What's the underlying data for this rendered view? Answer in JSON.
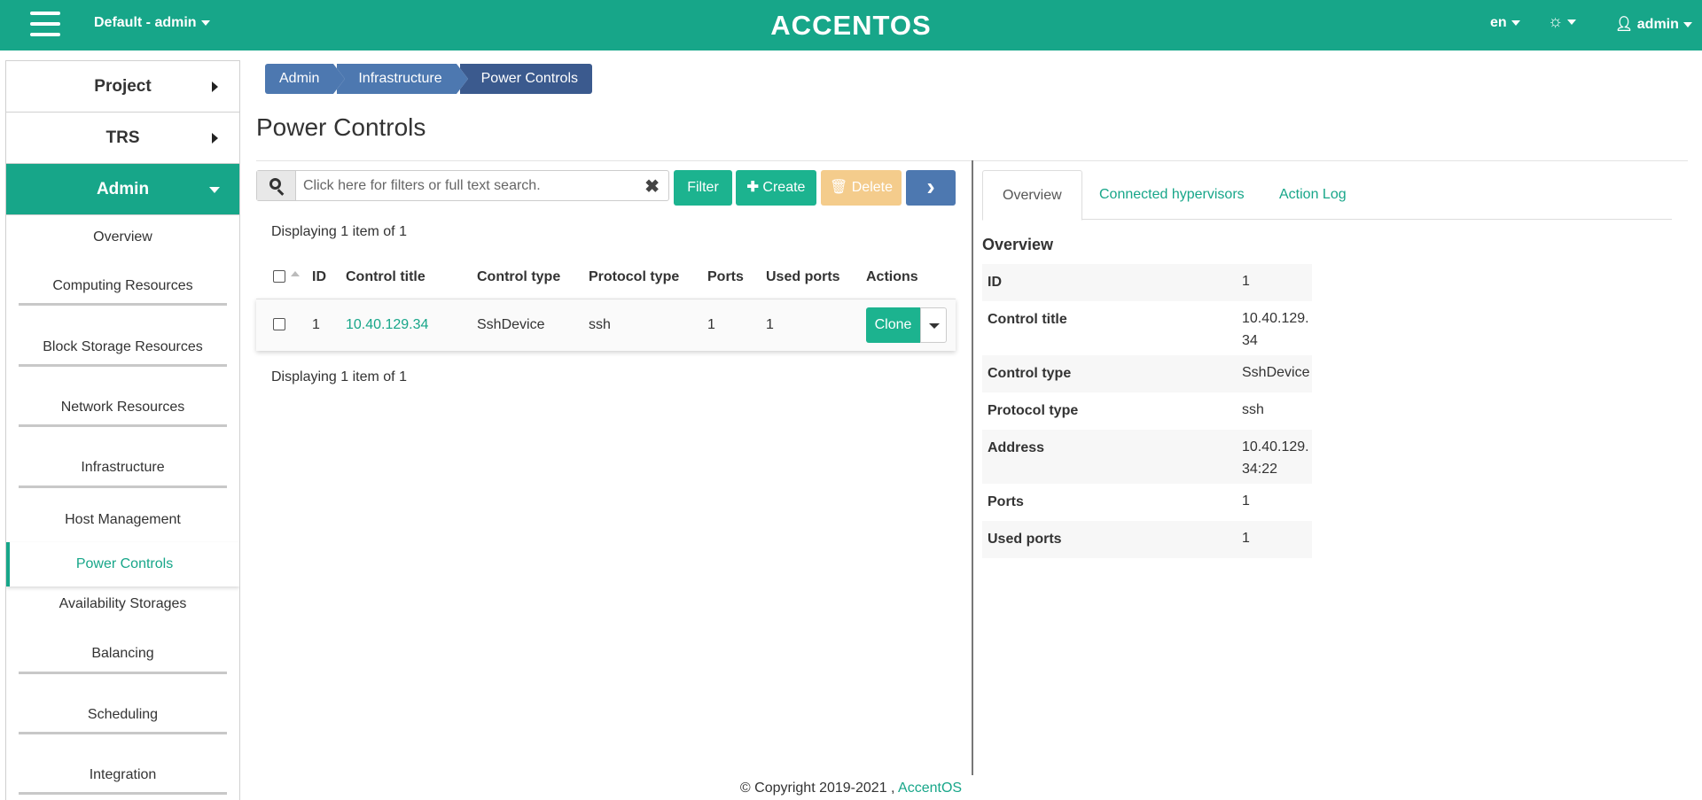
{
  "topbar": {
    "project": "Default - admin",
    "logo": "ACCENTOS",
    "lang": "en",
    "user": "admin"
  },
  "sidebar": {
    "sections": [
      {
        "label": "Project"
      },
      {
        "label": "TRS"
      },
      {
        "label": "Admin"
      }
    ],
    "items": [
      {
        "label": "Overview"
      },
      {
        "label": "Computing Resources"
      },
      {
        "label": "Block Storage Resources"
      },
      {
        "label": "Network Resources"
      },
      {
        "label": "Infrastructure"
      },
      {
        "label": "Host Management"
      },
      {
        "label": "Power Controls"
      },
      {
        "label": "Availability Storages"
      },
      {
        "label": "Balancing"
      },
      {
        "label": "Scheduling"
      },
      {
        "label": "Integration"
      }
    ]
  },
  "breadcrumb": [
    "Admin",
    "Infrastructure",
    "Power Controls"
  ],
  "page_title": "Power Controls",
  "toolbar": {
    "search_placeholder": "Click here for filters or full text search.",
    "filter": "Filter",
    "create": "Create",
    "delete": "Delete"
  },
  "display_count": "Displaying 1 item of 1",
  "table": {
    "columns": [
      "ID",
      "Control title",
      "Control type",
      "Protocol type",
      "Ports",
      "Used ports",
      "Actions"
    ],
    "rows": [
      {
        "id": "1",
        "title": "10.40.129.34",
        "type": "SshDevice",
        "protocol": "ssh",
        "ports": "1",
        "used_ports": "1",
        "action": "Clone"
      }
    ]
  },
  "detail": {
    "tabs": [
      "Overview",
      "Connected hypervisors",
      "Action Log"
    ],
    "heading": "Overview",
    "rows": [
      {
        "label": "ID",
        "value": "1"
      },
      {
        "label": "Control title",
        "value": "10.40.129.34"
      },
      {
        "label": "Control type",
        "value": "SshDevice"
      },
      {
        "label": "Protocol type",
        "value": "ssh"
      },
      {
        "label": "Address",
        "value": "10.40.129.34:22"
      },
      {
        "label": "Ports",
        "value": "1"
      },
      {
        "label": "Used ports",
        "value": "1"
      }
    ]
  },
  "footer": {
    "text": "© Copyright 2019-2021 ,",
    "link": "AccentOS"
  },
  "colors": {
    "accent": "#17a689",
    "primary_button": "#1cb38f",
    "breadcrumb": "#4d78b0",
    "delete_disabled": "#f4cc8c"
  }
}
